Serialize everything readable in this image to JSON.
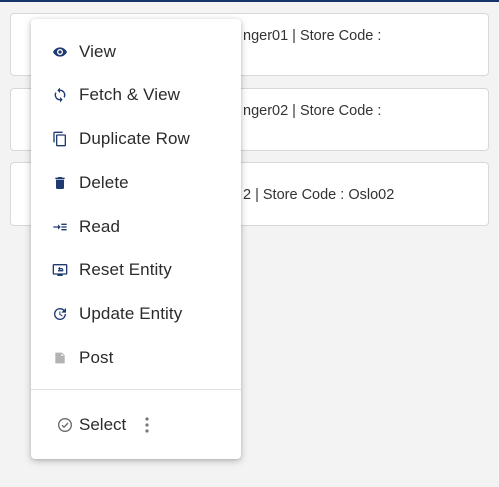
{
  "colors": {
    "accent": "#15346b",
    "icon": "#1f3a70",
    "muted_icon": "#a8a8a8"
  },
  "rows": [
    {
      "text": "nger01 | Store Code :"
    },
    {
      "text": "nger02 | Store Code :"
    },
    {
      "text": "2 | Store Code : Oslo02"
    }
  ],
  "menu": {
    "items": [
      {
        "label": "View",
        "icon": "eye-icon"
      },
      {
        "label": "Fetch & View",
        "icon": "refresh-icon"
      },
      {
        "label": "Duplicate Row",
        "icon": "copy-icon"
      },
      {
        "label": "Delete",
        "icon": "trash-icon"
      },
      {
        "label": "Read",
        "icon": "read-icon"
      },
      {
        "label": "Reset Entity",
        "icon": "reset-icon"
      },
      {
        "label": "Update Entity",
        "icon": "update-icon"
      },
      {
        "label": "Post",
        "icon": "post-icon"
      }
    ],
    "select_label": "Select"
  }
}
